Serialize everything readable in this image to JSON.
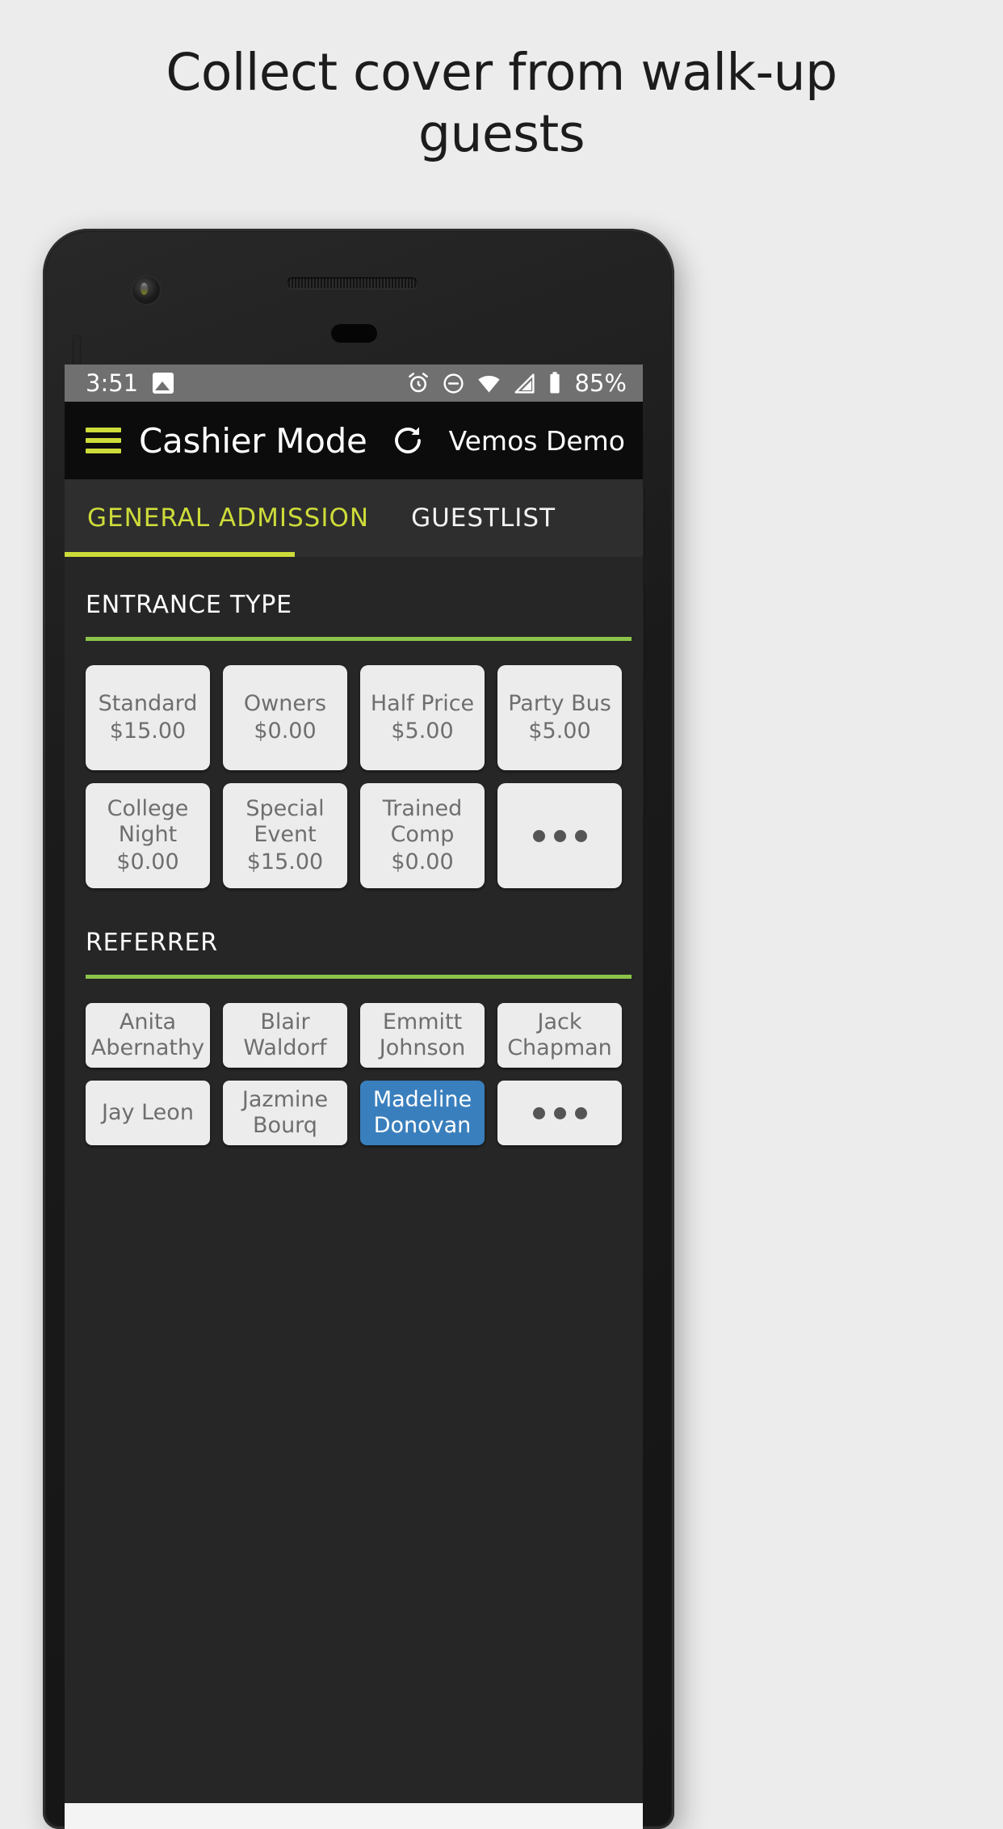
{
  "headline": "Collect cover from walk-up guests",
  "status_bar": {
    "time": "3:51",
    "battery_percent": "85%",
    "icons": [
      "image-icon",
      "alarm-icon",
      "do-not-disturb-icon",
      "wifi-icon",
      "cellular-signal-icon",
      "battery-icon"
    ]
  },
  "app_bar": {
    "menu_icon": "hamburger-menu-icon",
    "title": "Cashier Mode",
    "refresh_icon": "refresh-icon",
    "venue": "Vemos Demo"
  },
  "tabs": [
    {
      "label": "GENERAL ADMISSION",
      "active": true
    },
    {
      "label": "GUESTLIST",
      "active": false
    }
  ],
  "sections": {
    "entrance_type": {
      "title": "ENTRANCE TYPE",
      "items": [
        {
          "name": "Standard",
          "price": "$15.00",
          "selected": false
        },
        {
          "name": "Owners",
          "price": "$0.00",
          "selected": false
        },
        {
          "name": "Half Price",
          "price": "$5.00",
          "selected": false
        },
        {
          "name": "Party Bus",
          "price": "$5.00",
          "selected": false
        },
        {
          "name": "College\nNight",
          "price": "$0.00",
          "selected": false
        },
        {
          "name": "Special\nEvent",
          "price": "$15.00",
          "selected": false
        },
        {
          "name": "Trained\nComp",
          "price": "$0.00",
          "selected": false
        },
        {
          "name": "",
          "price": "",
          "more": true,
          "selected": false
        }
      ]
    },
    "referrer": {
      "title": "REFERRER",
      "items": [
        {
          "name": "Anita\nAbernathy",
          "selected": false
        },
        {
          "name": "Blair\nWaldorf",
          "selected": false
        },
        {
          "name": "Emmitt\nJohnson",
          "selected": false
        },
        {
          "name": "Jack\nChapman",
          "selected": false
        },
        {
          "name": "Jay Leon",
          "selected": false
        },
        {
          "name": "Jazmine\nBourq",
          "selected": false
        },
        {
          "name": "Madeline\nDonovan",
          "selected": true
        },
        {
          "name": "",
          "more": true,
          "selected": false
        }
      ]
    }
  },
  "colors": {
    "accent_lime": "#cddc39",
    "accent_green": "#8bc34a",
    "selected_blue": "#3a7fbd",
    "card_bg": "#ececec",
    "screen_bg": "#262626",
    "appbar_bg": "#0c0c0c",
    "page_bg": "#ececec"
  }
}
